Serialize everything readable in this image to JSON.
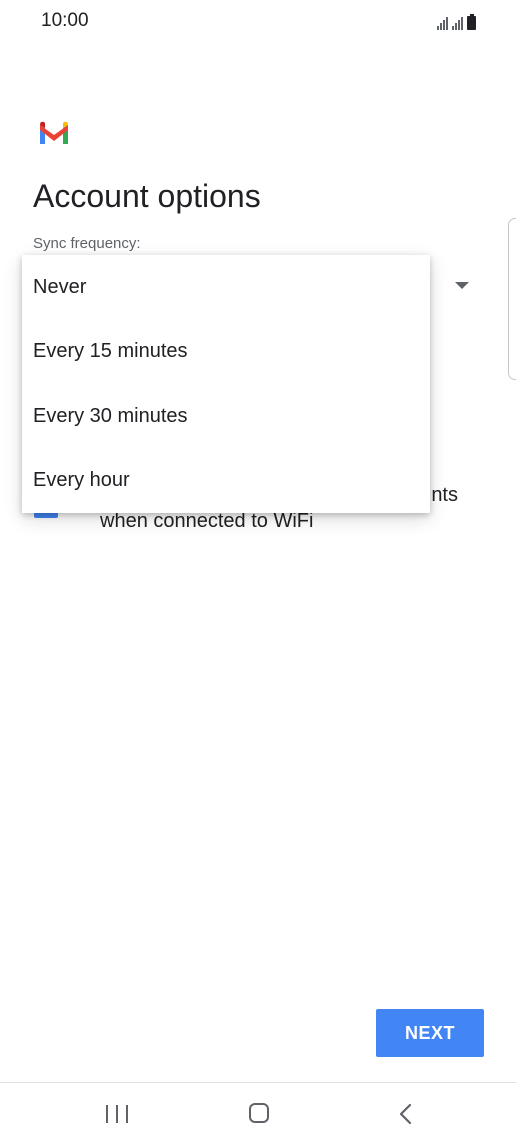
{
  "status_bar": {
    "time": "10:00",
    "icons": [
      "signal-icon",
      "signal-icon",
      "battery-icon"
    ]
  },
  "app": {
    "logo": "gmail-logo",
    "brand_colors": {
      "blue": "#4285f4",
      "red": "#ea4335",
      "yellow": "#fbbc04",
      "green": "#34a853"
    }
  },
  "page": {
    "title": "Account options"
  },
  "sync": {
    "label": "Sync frequency:",
    "options": [
      "Never",
      "Every 15 minutes",
      "Every 30 minutes",
      "Every hour"
    ]
  },
  "checkbox": {
    "label": "nts\nwhen connected to WiFi",
    "visible_fragment_line1": "nts",
    "visible_fragment_line2": "when connected to WiFi",
    "checked": true
  },
  "footer": {
    "next_label": "NEXT",
    "accent": "#4285f4"
  },
  "nav": {
    "icons": [
      "recents-icon",
      "home-icon",
      "back-icon"
    ]
  }
}
